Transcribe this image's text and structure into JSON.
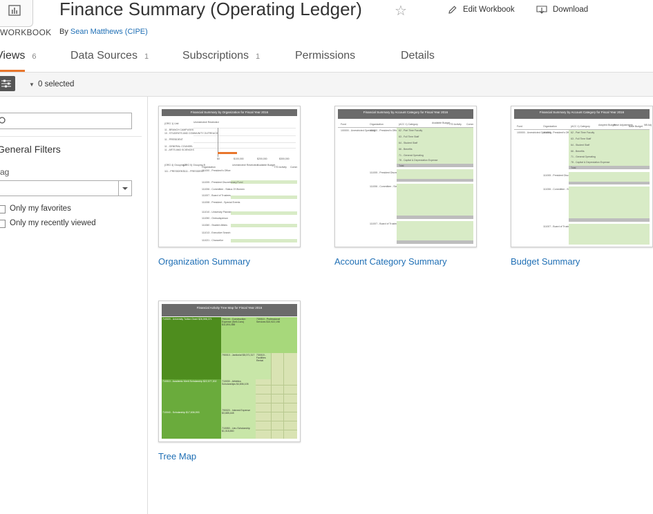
{
  "header": {
    "workbook_type": "WORKBOOK",
    "title": "Finance Summary (Operating Ledger)",
    "by_prefix": "By",
    "author": "Sean Matthews (CIPE)",
    "edit_label": "Edit Workbook",
    "download_label": "Download"
  },
  "tabs": [
    {
      "label": "Views",
      "count": "6"
    },
    {
      "label": "Data Sources",
      "count": "1"
    },
    {
      "label": "Subscriptions",
      "count": "1"
    },
    {
      "label": "Permissions",
      "count": ""
    },
    {
      "label": "Details",
      "count": ""
    }
  ],
  "toolbar": {
    "selected": "0 selected"
  },
  "sidebar": {
    "filters_title": "General Filters",
    "tag_label": "ag",
    "favorites_label": "Only my favorites",
    "recent_label": "Only my recently viewed"
  },
  "views": [
    {
      "label": "Organization Summary",
      "thumb_title": "Financial Summary by Organization for Fiscal Year 2016",
      "headers": [
        "(ORG 1) Unit",
        "Unrestricted/ Restricted"
      ],
      "rows": [
        "11 - BRANCH CAMPUSES",
        "10 - STUDENTS AND COMMUNITY OUTREACH",
        "11 - PRESIDENT",
        "11 - GENERAL COUNSEL",
        "11 - ARTS AND SCIENCES"
      ],
      "axis": [
        "$0",
        "$100,000",
        "$200,000",
        "$300,000"
      ],
      "table_headers": [
        "(ORG 4) Grouping A",
        "(ORG 5) Grouping B",
        "Organization",
        "Unrestricted/ Restricted",
        "Available Budget",
        "YTD Activity",
        "Comm"
      ],
      "orgs": [
        "111000 - President's Office",
        "111005 - President Discretionary Fund",
        "111006 - Committee - Status Of Women",
        "111007 - Board of Trustees",
        "111008 - President - Special Events",
        "111010 - University Planner",
        "111050 - Ombudsperson",
        "111060 - Student Affairs",
        "111013 - Executive Search",
        "111021 - Chancellor"
      ],
      "group_a": "111 - PRESIDENT",
      "group_b": "1111 - PRESIDENT"
    },
    {
      "label": "Account Category Summary",
      "thumb_title": "Financial Summary by Account Category for Fiscal Year 2016",
      "headers": [
        "Fund",
        "Organization",
        "(ACC 1) Category",
        "Available Budget",
        "YTD Activity",
        "Comm"
      ],
      "fund": "100000 - Unrestricted Operating",
      "orgs": [
        "111000 - President's Office",
        "111005 - President Discretionary Fund",
        "111006 - Committee - Status Of Women",
        "111007 - Board of Trustees"
      ],
      "categories": [
        "62 - Part Time Faculty",
        "63 - Full Time Staff",
        "64 - Student Staff",
        "66 - Benefits",
        "71 - General Operating",
        "78 - Capital & Depreciation Expense",
        "Total"
      ]
    },
    {
      "label": "Budget Summary",
      "thumb_title": "Financial Summary by Account Category for Fiscal Year 2016",
      "headers": [
        "Fund",
        "Organization",
        "(ACC 1) Category",
        "Adopted Budget",
        "Base Adjustments",
        "Base Budget",
        "NB Adj"
      ],
      "fund": "100000 - Unrestricted Operating",
      "orgs": [
        "111000 - President's Office",
        "111005 - President Discretionary Fund",
        "111006 - Committee - Status Of Women",
        "111007 - Board of Trustees"
      ],
      "categories": [
        "62 - Part Time Faculty",
        "63 - Full Time Staff",
        "64 - Student Staff",
        "66 - Benefits",
        "71 - General Operating",
        "78 - Capital & Depreciation Expense",
        "Total"
      ]
    },
    {
      "label": "Tree Map",
      "thumb_title": "Financial Activity Tree Map for Fiscal Year 2016",
      "cells": [
        "710020 - University Tuition Grant $26,598,371",
        "790100 - Construction Expense (Self-Cons) $11,891,088",
        "730010 - Professional Services $10,922,198",
        "710010 - Academic Merit Scholarship $22,577,202",
        "790010 - Janitorial $8,071,317",
        "710030 - Athletics Scholarships $4,806,105",
        "730015 - Facilities Rental",
        "710040 - Scholarship $17,636,993",
        "790020 - Interest Expense $3,685,448",
        "710050 - Lieu Scholarship $1,018,850",
        "710080 - Other Operating Expense $1,003,988"
      ]
    }
  ],
  "colors": {
    "accent": "#e8762c",
    "link": "#1f6fb5",
    "treemap_dark": "#4e8d1e",
    "treemap_mid": "#6aab3c",
    "treemap_light": "#a7d87b",
    "treemap_pale": "#d9e3b3"
  }
}
